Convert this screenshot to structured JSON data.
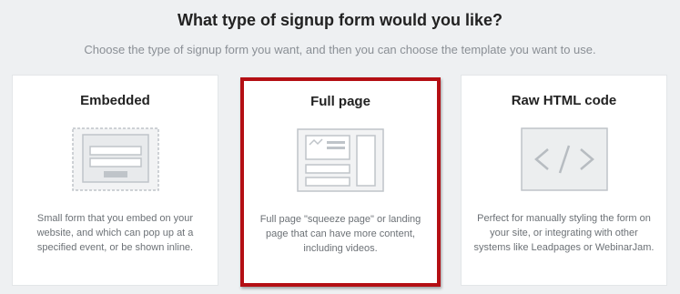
{
  "header": {
    "title": "What type of signup form would you like?",
    "subtitle": "Choose the type of signup form you want, and then you can choose the template you want to use."
  },
  "cards": [
    {
      "title": "Embedded",
      "description": "Small form that you embed on your website, and which can pop up at a specified event, or be shown inline.",
      "icon": "embedded-form-icon",
      "selected": false
    },
    {
      "title": "Full page",
      "description": "Full page \"squeeze page\" or landing page that can have more content, including videos.",
      "icon": "full-page-form-icon",
      "selected": true
    },
    {
      "title": "Raw HTML code",
      "description": "Perfect for manually styling the form on your site, or integrating with other systems like Leadpages or WebinarJam.",
      "icon": "code-icon",
      "selected": false
    }
  ],
  "colors": {
    "background": "#eef0f2",
    "selected_border": "#b40f14",
    "icon_stroke": "#bfc4c9",
    "icon_fill": "#f2f3f4"
  }
}
